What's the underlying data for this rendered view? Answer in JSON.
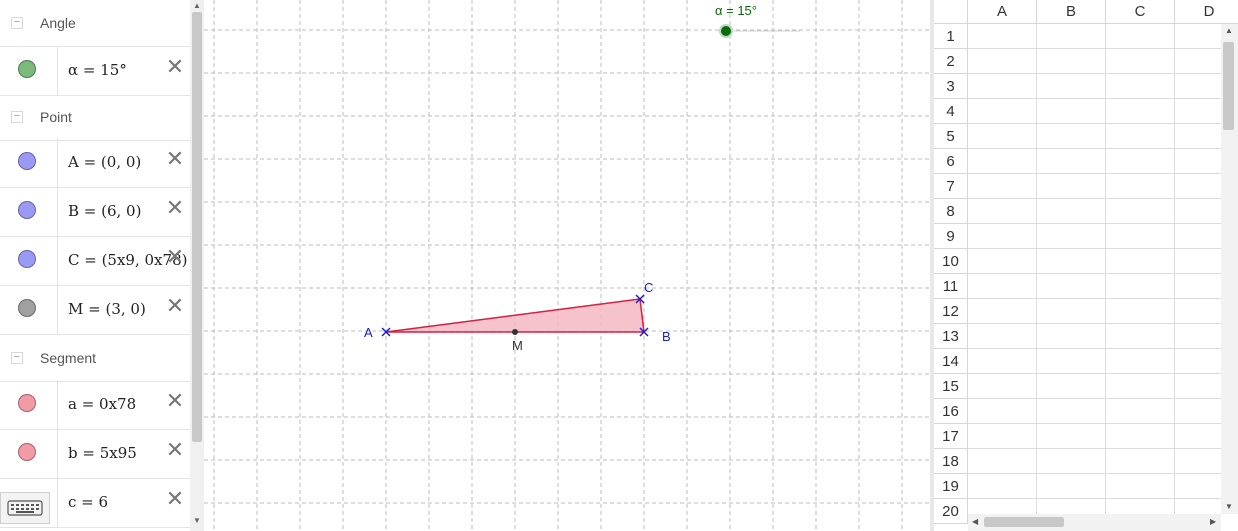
{
  "algebra": {
    "groups": [
      {
        "label": "Angle",
        "items": [
          {
            "definition": "α = 15°",
            "color": "#7cb97c"
          }
        ]
      },
      {
        "label": "Point",
        "items": [
          {
            "definition": "A = (0, 0)",
            "color": "#9a9af5"
          },
          {
            "definition": "B = (6, 0)",
            "color": "#9a9af5"
          },
          {
            "definition": "C = (5x9, 0x78)",
            "color": "#9a9af5"
          },
          {
            "definition": "M = (3, 0)",
            "color": "#a0a0a0"
          }
        ]
      },
      {
        "label": "Segment",
        "items": [
          {
            "definition": "a = 0x78",
            "color": "#f29aa5"
          },
          {
            "definition": "b = 5x95",
            "color": "#f29aa5"
          },
          {
            "definition": "c = 6",
            "color": "#f29aa5"
          }
        ]
      }
    ],
    "collapse_symbol": "−",
    "delete_symbol": "✕"
  },
  "graphics": {
    "slider_label": "α = 15°",
    "points": {
      "A": "A",
      "B": "B",
      "C": "C",
      "M": "M"
    },
    "colors": {
      "point": "#1a1ad6",
      "triangle_fill": "#f4b7c2",
      "triangle_stroke": "#d42142",
      "slider": "#0a6a0a",
      "grid": "#bdbdbd"
    }
  },
  "spreadsheet": {
    "columns": [
      "A",
      "B",
      "C",
      "D"
    ],
    "rows": [
      "1",
      "2",
      "3",
      "4",
      "5",
      "6",
      "7",
      "8",
      "9",
      "10",
      "11",
      "12",
      "13",
      "14",
      "15",
      "16",
      "17",
      "18",
      "19",
      "20"
    ]
  }
}
